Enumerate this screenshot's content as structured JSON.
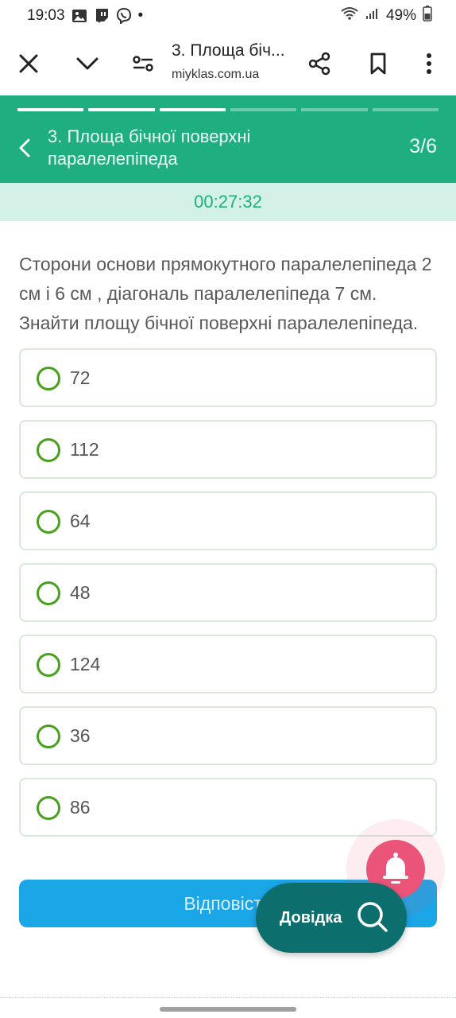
{
  "status_bar": {
    "time": "19:03",
    "dot": "•",
    "battery": "49%",
    "icons": [
      "gallery-icon",
      "twitch-icon",
      "viber-icon",
      "wifi-icon",
      "signal-icon",
      "battery-icon"
    ]
  },
  "browser": {
    "tab_title": "3. Площа біч...",
    "tab_url": "miyklas.com.ua",
    "icons": [
      "close-icon",
      "chevron-down-icon",
      "site-settings-icon",
      "share-icon",
      "bookmark-icon",
      "more-icon"
    ]
  },
  "quiz": {
    "title": "3. Площа бічної поверхні паралелепіпеда",
    "counter": "3/6",
    "timer": "00:27:32",
    "progress": {
      "completed": 3,
      "total": 6
    },
    "question": "Сторони основи прямокутного паралелепіпеда 2 см і 6 см , діагональ паралелепіпеда 7 см. Знайти площу бічної поверхні паралелепіпеда.",
    "options": [
      {
        "label": "72"
      },
      {
        "label": "112"
      },
      {
        "label": "64"
      },
      {
        "label": "48"
      },
      {
        "label": "124"
      },
      {
        "label": "36"
      },
      {
        "label": "86"
      }
    ],
    "answer_button": "Відповісти"
  },
  "help": {
    "label": "Довідка"
  },
  "colors": {
    "header_green": "#1fae80",
    "timer_bg": "#d3f1e6",
    "radio_green": "#47a11d",
    "answer_blue": "#1ba6e8",
    "help_teal": "#0c6f6d",
    "bell_pink": "#ea5478"
  }
}
